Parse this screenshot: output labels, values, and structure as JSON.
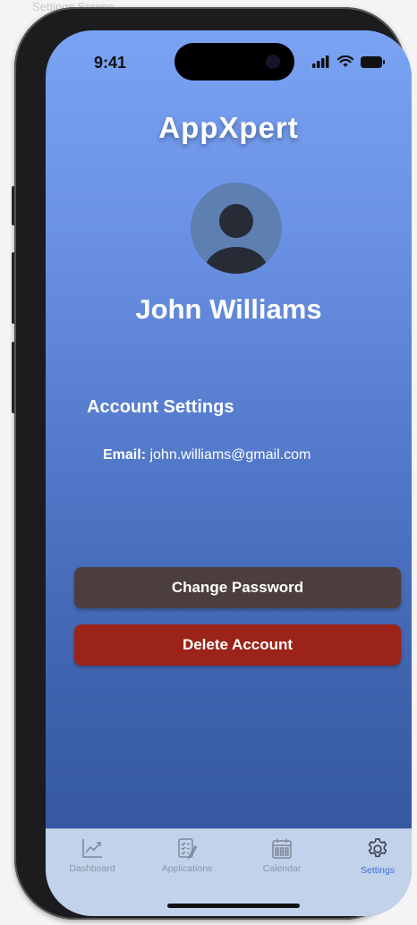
{
  "frame_label": "Settings Screen",
  "status_bar": {
    "time": "9:41"
  },
  "app": {
    "title": "AppXpert"
  },
  "profile": {
    "name": "John Williams"
  },
  "account_settings": {
    "title": "Account Settings",
    "email_label": "Email:",
    "email_value": "john.williams@gmail.com"
  },
  "buttons": {
    "change_password": "Change Password",
    "delete_account": "Delete Account"
  },
  "tabs": [
    {
      "label": "Dashboard",
      "icon": "chart-icon",
      "active": false
    },
    {
      "label": "Applications",
      "icon": "checklist-icon",
      "active": false
    },
    {
      "label": "Calendar",
      "icon": "calendar-icon",
      "active": false
    },
    {
      "label": "Settings",
      "icon": "gear-icon",
      "active": true
    }
  ],
  "colors": {
    "gradient_top": "#7aa3f4",
    "gradient_bottom": "#31529b",
    "change_password_bg": "#4b3e3c",
    "delete_account_bg": "#9b2319",
    "tab_active": "#3a6fe0",
    "tab_inactive": "#8a95a6",
    "tabbar_bg": "#c2d2ea"
  }
}
